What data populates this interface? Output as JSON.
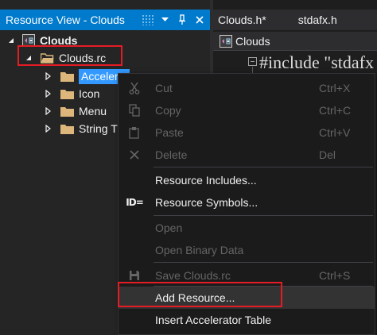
{
  "tool_window": {
    "title": "Resource View - Clouds"
  },
  "tree": {
    "project": "Clouds",
    "rc_file": "Clouds.rc",
    "folders": [
      {
        "label": "Accelerat"
      },
      {
        "label": "Icon"
      },
      {
        "label": "Menu"
      },
      {
        "label": "String T"
      }
    ]
  },
  "editor": {
    "tabs": [
      "Clouds.h*",
      "stdafx.h"
    ],
    "nav_label": "Clouds",
    "code_line": "#include \"stdafx"
  },
  "context_menu": {
    "items": [
      {
        "label": "Cut",
        "shortcut": "Ctrl+X",
        "icon": "cut-icon",
        "enabled": false
      },
      {
        "label": "Copy",
        "shortcut": "Ctrl+C",
        "icon": "copy-icon",
        "enabled": false
      },
      {
        "label": "Paste",
        "shortcut": "Ctrl+V",
        "icon": "paste-icon",
        "enabled": false
      },
      {
        "label": "Delete",
        "shortcut": "Del",
        "icon": "delete-icon",
        "enabled": false
      },
      {
        "label": "Resource Includes...",
        "shortcut": "",
        "icon": "",
        "enabled": true
      },
      {
        "label": "Resource Symbols...",
        "shortcut": "",
        "icon": "resource-symbols-icon",
        "enabled": true
      },
      {
        "label": "Open",
        "shortcut": "",
        "icon": "",
        "enabled": false
      },
      {
        "label": "Open Binary Data",
        "shortcut": "",
        "icon": "",
        "enabled": false
      },
      {
        "label": "Save Clouds.rc",
        "shortcut": "Ctrl+S",
        "icon": "save-icon",
        "enabled": false
      },
      {
        "label": "Add Resource...",
        "shortcut": "",
        "icon": "",
        "enabled": true
      },
      {
        "label": "Insert Accelerator Table",
        "shortcut": "",
        "icon": "",
        "enabled": true
      }
    ],
    "id_glyph": "ID="
  },
  "colors": {
    "accent": "#007acc",
    "selection": "#3399ff",
    "highlight_box": "#e51c23",
    "folder": "#dcb67a"
  }
}
